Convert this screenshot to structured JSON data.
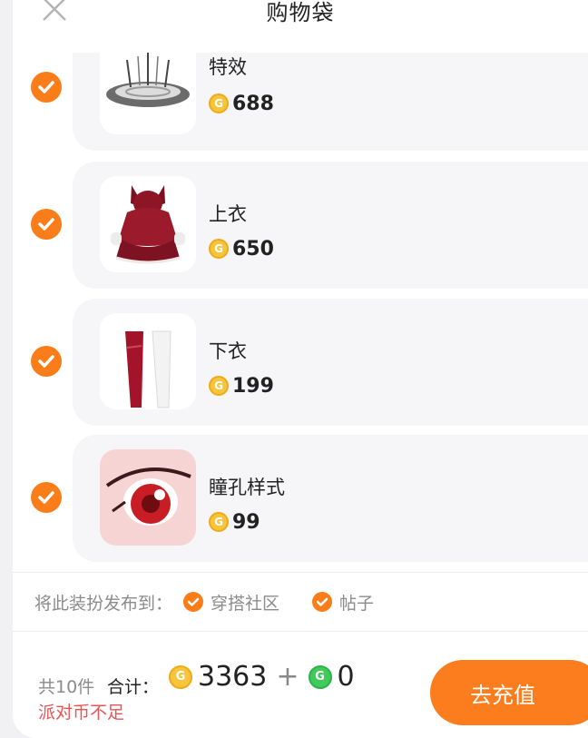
{
  "header": {
    "title": "购物袋",
    "close_icon": "close-icon"
  },
  "items": [
    {
      "name": "特效",
      "price": "688",
      "thumb": "effect-thumbnail"
    },
    {
      "name": "上衣",
      "price": "650",
      "thumb": "top-clothing-thumbnail"
    },
    {
      "name": "下衣",
      "price": "199",
      "thumb": "bottom-clothing-thumbnail"
    },
    {
      "name": "瞳孔样式",
      "price": "99",
      "thumb": "eye-style-thumbnail"
    }
  ],
  "publish": {
    "label": "将此装扮发布到：",
    "options": [
      {
        "label": "穿搭社区",
        "checked": true
      },
      {
        "label": "帖子",
        "checked": true
      }
    ]
  },
  "footer": {
    "count": "共10件",
    "total_label": "合计：",
    "gold_total": "3363",
    "plus": "+",
    "green_total": "0",
    "insufficient": "派对币不足",
    "recharge_label": "去充值"
  },
  "colors": {
    "accent": "#fb7d19",
    "gold": "#f7c53b",
    "green": "#3fca5a",
    "warning": "#e85454"
  }
}
